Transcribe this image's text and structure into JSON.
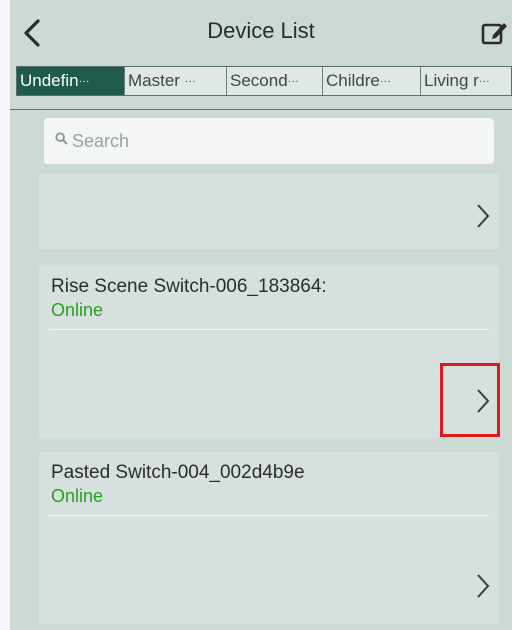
{
  "header": {
    "title": "Device List",
    "back_icon": "chevron-left-icon",
    "edit_icon": "edit-icon"
  },
  "tabs": [
    {
      "label": "Undefin",
      "active": true
    },
    {
      "label": "Master ",
      "active": false
    },
    {
      "label": "Second",
      "active": false
    },
    {
      "label": "Childre",
      "active": false
    },
    {
      "label": "Living r",
      "active": false
    }
  ],
  "search": {
    "placeholder": "Search"
  },
  "devices": [
    {
      "name": "",
      "status": ""
    },
    {
      "name": "Rise Scene Switch-006_183864:",
      "status": "Online"
    },
    {
      "name": "Pasted Switch-004_002d4b9e",
      "status": "Online"
    }
  ],
  "colors": {
    "background": "#ccdad6",
    "active_tab": "#1f5b4d",
    "online": "#27a01b",
    "highlight_box": "#e01818"
  }
}
